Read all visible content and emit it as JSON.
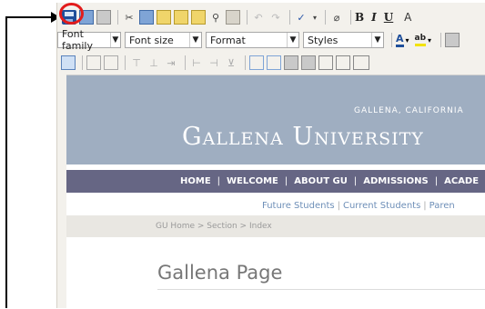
{
  "toolbar": {
    "row1": {
      "bold": "B",
      "italic": "I",
      "underline": "U"
    },
    "row2": {
      "font_family": "Font family",
      "font_size": "Font size",
      "format": "Format",
      "styles": "Styles",
      "text_color": "A",
      "highlight": "ab"
    }
  },
  "highlight_color": "#e21b1b",
  "page": {
    "location": "Gallena, California",
    "university": "Gallena University",
    "nav": [
      "HOME",
      "WELCOME",
      "ABOUT GU",
      "ADMISSIONS",
      "ACADE"
    ],
    "subnav": [
      "Future Students",
      "Current Students",
      "Paren"
    ],
    "breadcrumb": "GU Home > Section > Index",
    "title": "Gallena Page"
  }
}
